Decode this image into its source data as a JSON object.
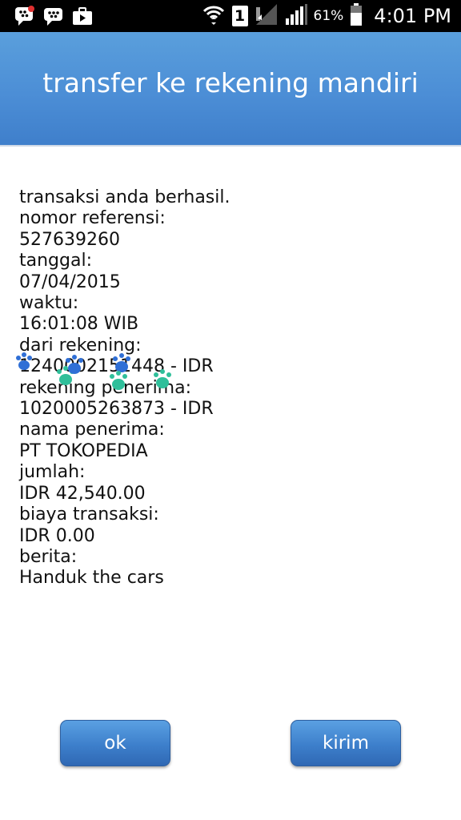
{
  "statusbar": {
    "notification_icons": [
      "bbm-icon",
      "bbm-chat-icon",
      "briefcase-icon"
    ],
    "sim_label": "1",
    "battery": "61%",
    "time": "4:01 PM"
  },
  "header": {
    "title": "transfer ke rekening mandiri"
  },
  "receipt": {
    "status": "transaksi anda berhasil.",
    "ref_label": "nomor referensi:",
    "ref_value": "527639260",
    "date_label": "tanggal:",
    "date_value": "07/04/2015",
    "time_label": "waktu:",
    "time_value": "16:01:08 WIB",
    "from_label": "dari rekening:",
    "from_value": "1240002151448 - IDR",
    "to_label": "rekening penerima:",
    "to_value": "1020005263873 - IDR",
    "name_label": "nama penerima:",
    "name_value": "PT TOKOPEDIA",
    "amount_label": "jumlah:",
    "amount_value": "IDR 42,540.00",
    "fee_label": "biaya transaksi:",
    "fee_value": "IDR 0.00",
    "note_label": "berita:",
    "note_value": "Handuk the cars"
  },
  "buttons": {
    "ok": "ok",
    "kirim": "kirim"
  },
  "colors": {
    "header_blue": "#4c8ed6",
    "button_blue": "#3d7fcb",
    "paw_blue": "#2f6fd6",
    "paw_teal": "#2fbf9a"
  }
}
